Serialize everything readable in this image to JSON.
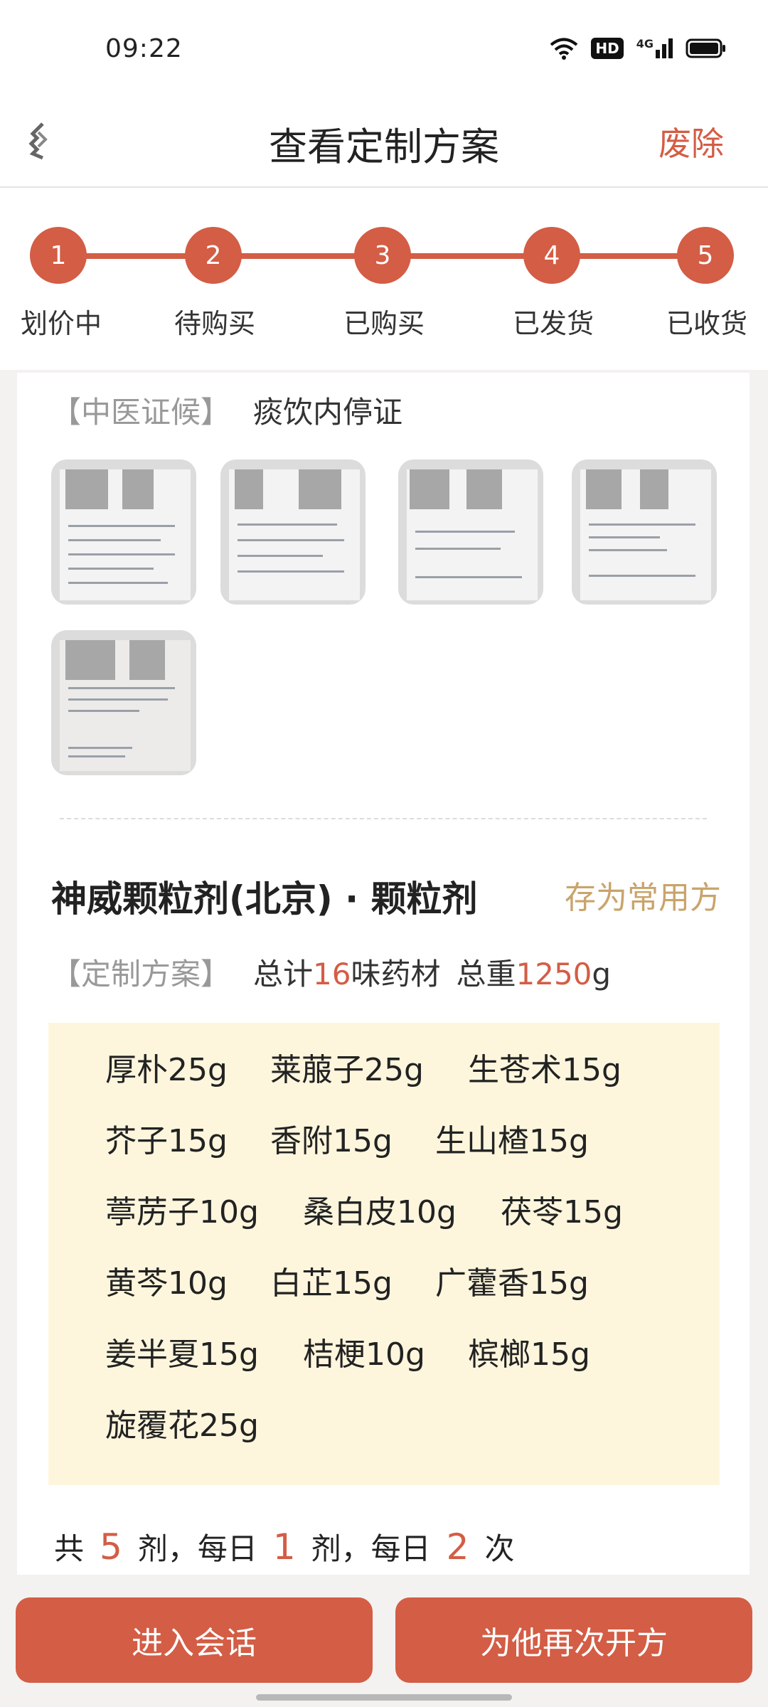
{
  "status_bar": {
    "time": "09:22",
    "hd_label": "HD",
    "network_label": "4G"
  },
  "nav": {
    "title": "查看定制方案",
    "abandon_label": "废除"
  },
  "steps": [
    {
      "num": "1",
      "label": "划价中"
    },
    {
      "num": "2",
      "label": "待购买"
    },
    {
      "num": "3",
      "label": "已购买"
    },
    {
      "num": "4",
      "label": "已发货"
    },
    {
      "num": "5",
      "label": "已收货"
    }
  ],
  "diagnosis": {
    "tag": "【中医证候】",
    "value": "痰饮内停证"
  },
  "product": {
    "title": "神威颗粒剂(北京) · 颗粒剂",
    "save_label": "存为常用方"
  },
  "summary": {
    "tag": "【定制方案】",
    "count_prefix": "总计",
    "count": "16",
    "count_suffix": "味药材",
    "weight_prefix": "总重",
    "weight": "1250",
    "weight_unit": "g"
  },
  "herbs": [
    "厚朴25g",
    "莱菔子25g",
    "生苍术15g",
    "芥子15g",
    "香附15g",
    "生山楂15g",
    "葶苈子10g",
    "桑白皮10g",
    "茯苓15g",
    "黄芩10g",
    "白芷15g",
    "广藿香15g",
    "姜半夏15g",
    "桔梗10g",
    "槟榔15g",
    "旋覆花25g"
  ],
  "dosage": {
    "p1": "共",
    "n1": "5",
    "p2": "剂，每日",
    "n2": "1",
    "p3": "剂，每日",
    "n3": "2",
    "p4": "次"
  },
  "buttons": {
    "enter_chat": "进入会话",
    "represcribe": "为他再次开方"
  },
  "colors": {
    "accent": "#d35d45",
    "gold": "#c9a46b",
    "recipe_bg": "#fdf6dd"
  }
}
